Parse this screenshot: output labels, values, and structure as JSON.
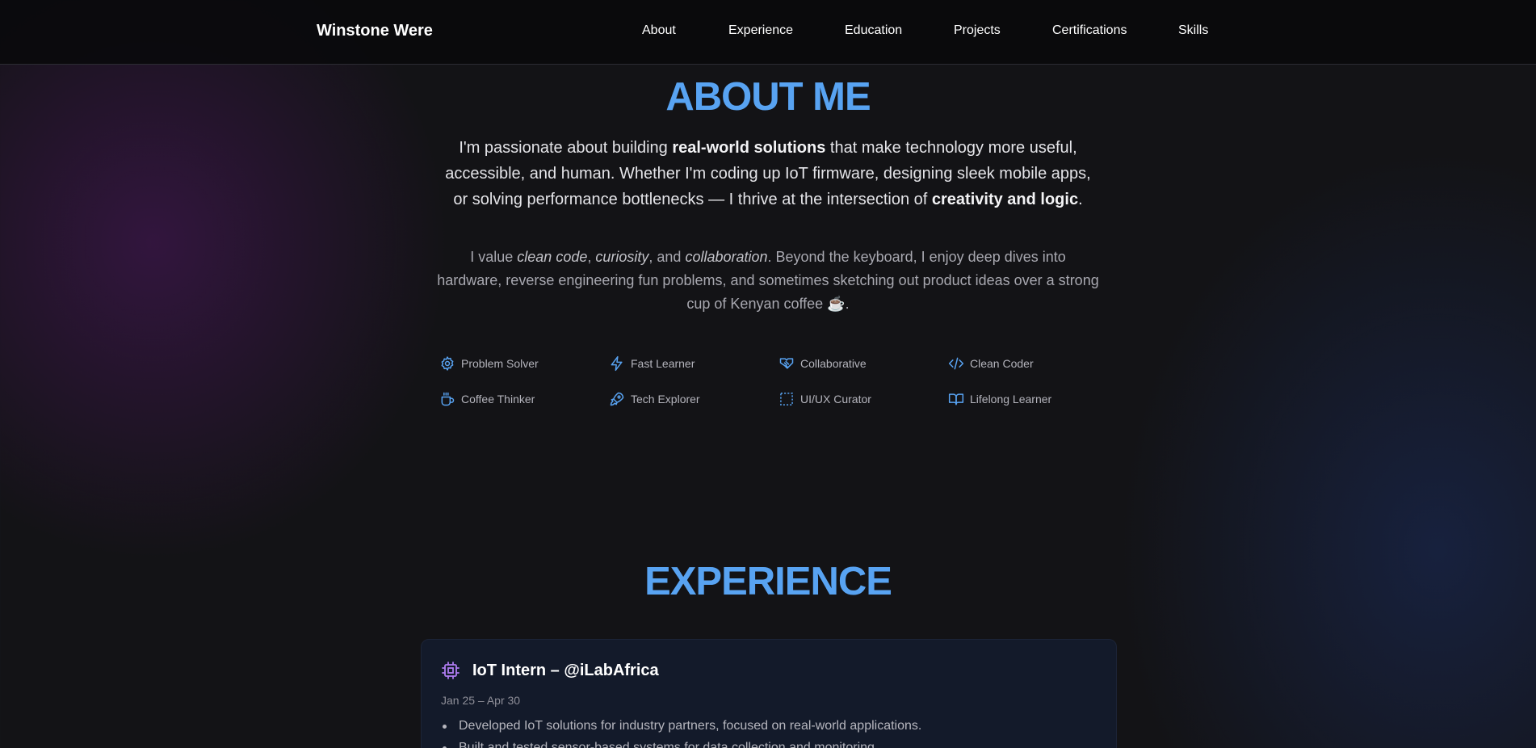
{
  "header": {
    "brand": "Winstone Were",
    "nav": [
      "About",
      "Experience",
      "Education",
      "Projects",
      "Certifications",
      "Skills"
    ]
  },
  "about": {
    "title": "ABOUT ME",
    "lead": {
      "p1": "I'm passionate about building ",
      "b1": "real-world solutions",
      "p2": " that make technology more useful, accessible, and human. Whether I'm coding up IoT firmware, designing sleek mobile apps, or solving performance bottlenecks — I thrive at the intersection of ",
      "b2": "creativity and logic",
      "p3": "."
    },
    "sub": {
      "p1": "I value ",
      "i1": "clean code",
      "p2": ", ",
      "i2": "curiosity",
      "p3": ", and ",
      "i3": "collaboration",
      "p4": ". Beyond the keyboard, I enjoy deep dives into hardware, reverse engineering fun problems, and sometimes sketching out product ideas over a strong cup of Kenyan coffee ☕."
    },
    "traits": [
      {
        "label": "Problem Solver",
        "icon": "gear-icon"
      },
      {
        "label": "Fast Learner",
        "icon": "lightning-icon"
      },
      {
        "label": "Collaborative",
        "icon": "handshake-icon"
      },
      {
        "label": "Clean Coder",
        "icon": "code-icon"
      },
      {
        "label": "Coffee Thinker",
        "icon": "coffee-cup-icon"
      },
      {
        "label": "Tech Explorer",
        "icon": "rocket-icon"
      },
      {
        "label": "UI/UX Curator",
        "icon": "dashed-square-icon"
      },
      {
        "label": "Lifelong Learner",
        "icon": "open-book-icon"
      }
    ]
  },
  "experience": {
    "title": "EXPERIENCE",
    "items": [
      {
        "icon": "cpu-chip-icon",
        "title": "IoT Intern – @iLabAfrica",
        "date": "Jan 25 – Apr 30",
        "bullets": [
          "Developed IoT solutions for industry partners, focused on real-world applications.",
          "Built and tested sensor-based systems for data collection and monitoring."
        ]
      }
    ]
  },
  "colors": {
    "accent": "#58a3f2",
    "chip_icon": "#b07cf2",
    "background": "#131316",
    "card": "#131a2a"
  }
}
